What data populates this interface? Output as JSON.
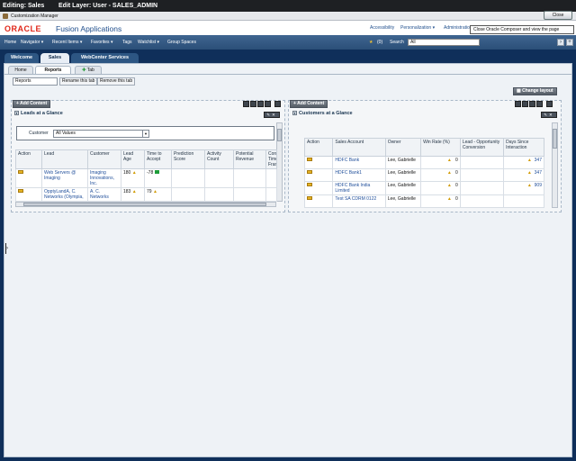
{
  "window": {
    "title_left": "Editing: Sales",
    "title_right": "Edit Layer: User - SALES_ADMIN"
  },
  "composer": {
    "label": "Customization Manager",
    "close_label": "Close",
    "tooltip": "Close Oracle Composer and view the page"
  },
  "brand": {
    "logo": "ORACLE",
    "product": "Fusion Applications"
  },
  "top_links": {
    "accessibility": "Accessibility",
    "personalization": "Personalization ▾",
    "administration": "Administration"
  },
  "nav": {
    "items": [
      "Home",
      "Navigator ▾",
      "Recent Items ▾",
      "Favorites ▾",
      "Tags",
      "Watchlist ▾",
      "Group Spaces"
    ],
    "count": "(0)",
    "search_label": "Search",
    "search_scope": "All"
  },
  "main_tabs": [
    "Welcome",
    "Sales",
    "WebCenter Services"
  ],
  "sub_tabs": {
    "home": "Home",
    "reports": "Reports",
    "add": "Tab"
  },
  "tab_edit": {
    "name_value": "Reports",
    "rename": "Rename this tab",
    "remove": "Remove this tab"
  },
  "layout": {
    "change": "Change layout",
    "add_content": "+ Add Content"
  },
  "leads": {
    "title": "Leads at a Glance",
    "filter_label": "Customer",
    "filter_value": "All Values",
    "columns": [
      "Action",
      "Lead",
      "Customer",
      "Lead Age",
      "Time to Accept",
      "Prediction Score",
      "Activity Count",
      "Potential Revenue",
      "Con Time Fram"
    ],
    "rows": [
      {
        "lead": "Web Servers @ Imaging",
        "customer": "Imaging Innovations, Inc.",
        "age": "180",
        "accept": "-78"
      },
      {
        "lead": "OpptyLandA, C. Networks (Olympia,",
        "customer": "A. C. Networks",
        "age": "183",
        "accept": "79"
      }
    ]
  },
  "customers": {
    "title": "Customers at a Glance",
    "columns": [
      "Action",
      "Sales Account",
      "Owner",
      "Win Rate (%)",
      "Lead - Opportunity Conversion",
      "Days Since Interaction"
    ],
    "rows": [
      {
        "account": "HDFC Bank",
        "owner": "Lee, Gabrielle",
        "win": "0",
        "days": "347"
      },
      {
        "account": "HDFC Bank1",
        "owner": "Lee, Gabrielle",
        "win": "0",
        "days": "347"
      },
      {
        "account": "HDFC Bank India Limited",
        "owner": "Lee, Gabrielle",
        "win": "0",
        "days": "909"
      },
      {
        "account": "Test SA CDRM 0122",
        "owner": "Lee, Gabrielle",
        "win": "0",
        "days": ""
      }
    ]
  }
}
